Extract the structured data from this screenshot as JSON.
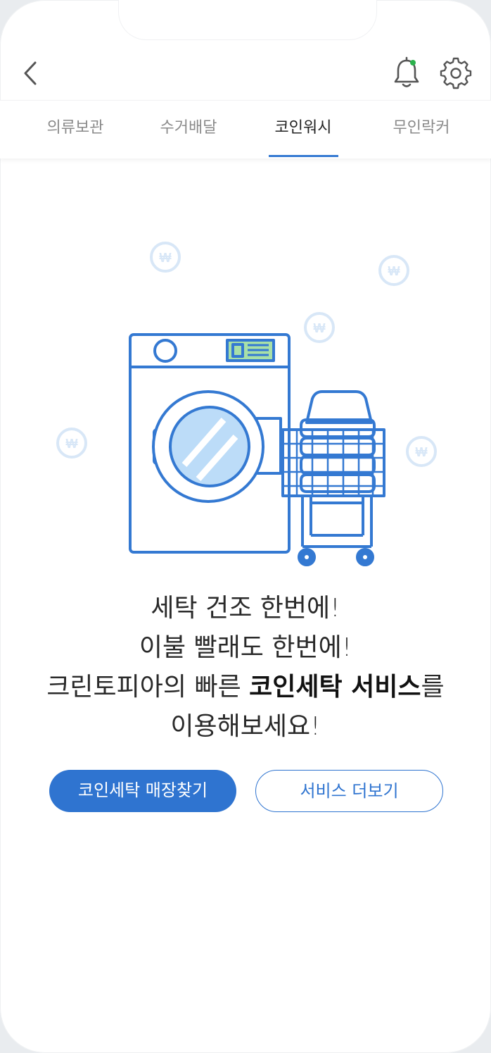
{
  "header": {
    "back_icon": "chevron-left-icon",
    "notification_icon": "bell-icon",
    "settings_icon": "gear-icon",
    "notification_dot_color": "#2bb24c"
  },
  "tabs": [
    {
      "label": "의류보관",
      "active": false
    },
    {
      "label": "수거배달",
      "active": false
    },
    {
      "label": "코인워시",
      "active": true
    },
    {
      "label": "무인락커",
      "active": false
    }
  ],
  "illustration": {
    "subject": "washing-machine-with-laundry-cart",
    "coin_icon": "won-coin-icon"
  },
  "message": {
    "line1": "세탁 건조 한번에!",
    "line2": "이불 빨래도 한번에!",
    "line3_prefix": "크린토피아의 빠른 ",
    "line3_bold": "코인세탁 서비스",
    "line3_suffix": "를",
    "line4": "이용해보세요!"
  },
  "buttons": {
    "find_store": "코인세탁 매장찾기",
    "more_services": "서비스 더보기"
  },
  "colors": {
    "accent": "#2f74d0",
    "coin": "#d8e7f7",
    "line_art": "#3479d2",
    "door_glass": "#bcdcf8",
    "display_panel": "#a8e0a8"
  }
}
